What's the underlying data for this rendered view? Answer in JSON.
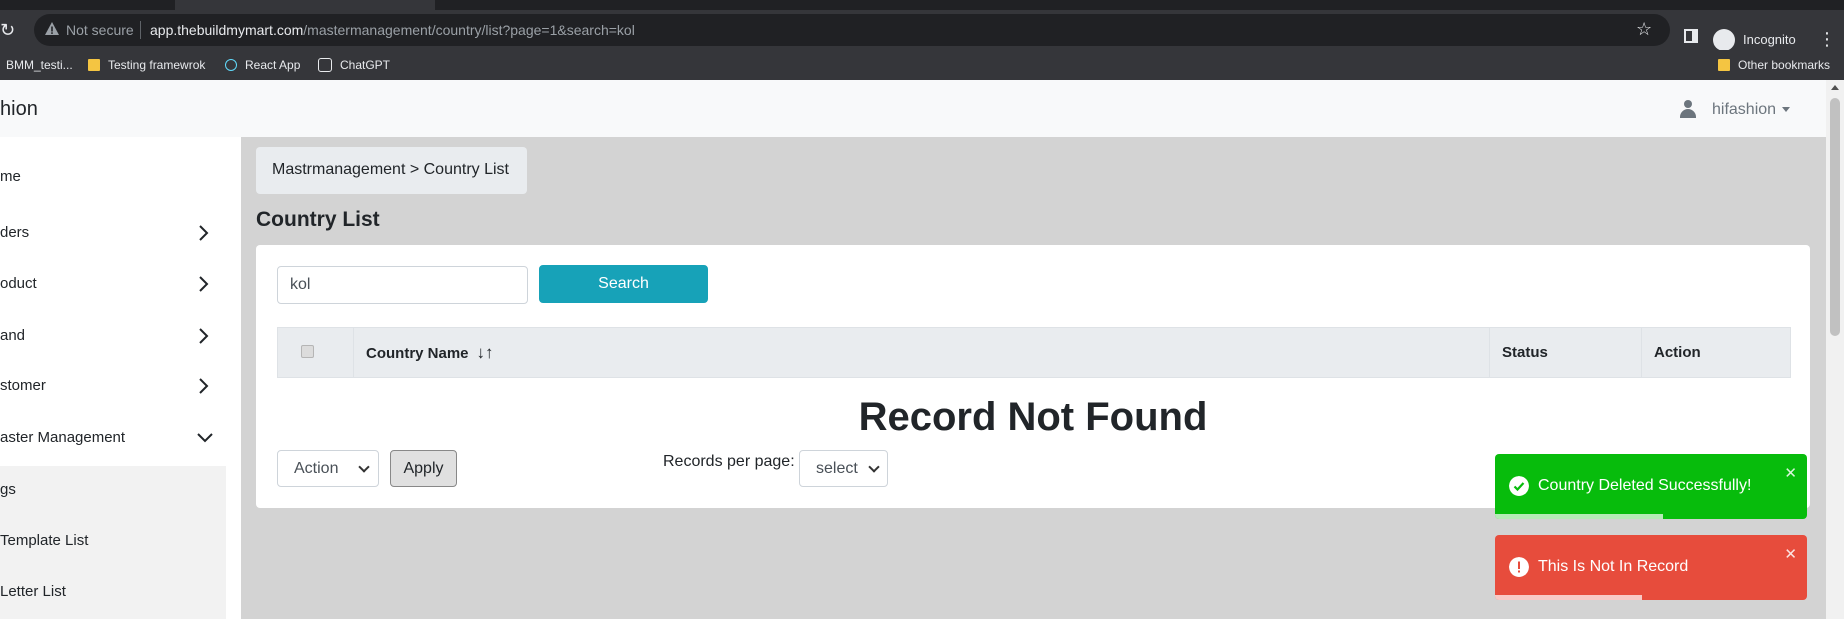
{
  "browser": {
    "security_label": "Not secure",
    "url_host": "app.thebuildmymart.com",
    "url_path": "/mastermanagement/country/list?page=1&search=kol",
    "profile_label": "Incognito"
  },
  "bookmarks": {
    "items": [
      "BMM_testi...",
      "Testing framewrok",
      "React App",
      "ChatGPT"
    ],
    "other_label": "Other bookmarks"
  },
  "header": {
    "brand": "hion",
    "username": "hifashion"
  },
  "sidebar": {
    "items": [
      {
        "label": "me"
      },
      {
        "label": "ders"
      },
      {
        "label": "oduct"
      },
      {
        "label": "and"
      },
      {
        "label": "stomer"
      },
      {
        "label": "aster Management"
      }
    ],
    "submenu": [
      {
        "label": "gs"
      },
      {
        "label": "Template List"
      },
      {
        "label": "Letter List"
      }
    ]
  },
  "breadcrumb": {
    "text": "Mastrmanagement > Country List"
  },
  "page": {
    "title": "Country List"
  },
  "search": {
    "value": "kol",
    "button_label": "Search"
  },
  "table": {
    "columns": [
      "Country Name",
      "Status",
      "Action"
    ],
    "empty_message": "Record Not Found"
  },
  "footer_controls": {
    "action_selected": "Action",
    "apply_label": "Apply",
    "records_label": "Records per page:",
    "records_selected": "select"
  },
  "toasts": [
    {
      "message": "Country Deleted Successfully!",
      "type": "success",
      "color": "#07bc0c",
      "progress": 0.54
    },
    {
      "message": "This Is Not In Record",
      "type": "error",
      "color": "#e74c3c",
      "progress": 0.47
    }
  ],
  "colors": {
    "primary_button": "#17a2b8",
    "content_background": "#d3d3d3"
  }
}
